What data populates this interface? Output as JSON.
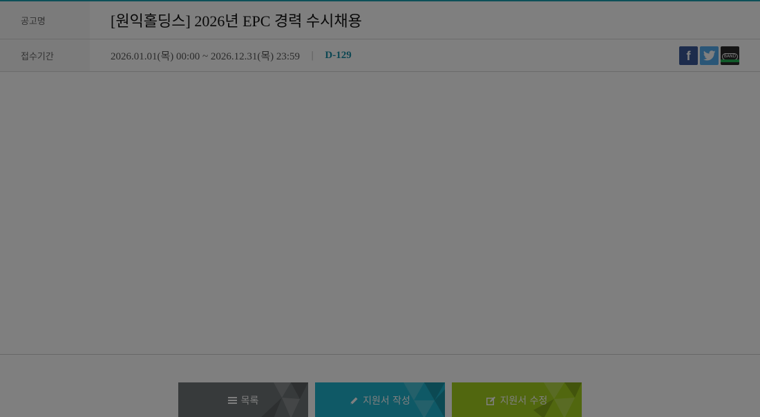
{
  "posting": {
    "title_label": "공고명",
    "title": "[원익홀딩스] 2026년 EPC 경력 수시채용",
    "period_label": "접수기간",
    "period": "2026.01.01(목) 00:00 ~ 2026.12.31(목) 23:59",
    "separator": "|",
    "d_day": "D-129"
  },
  "share": {
    "facebook_glyph": "f",
    "band_text": "BAND"
  },
  "actions": {
    "list_label": "목록",
    "write_label": "지원서 작성",
    "edit_label": "지원서 수정"
  },
  "colors": {
    "accent": "#1a9fb0",
    "d_day": "#1a8fa6",
    "list_button": "#6f7477",
    "write_button": "#1fb3cc",
    "edit_button": "#a3cf1f",
    "facebook": "#3b5998",
    "twitter": "#55acee",
    "band": "#2b2b2b",
    "modal_overlay": "rgba(0,0,0,0.5)"
  },
  "icons": {
    "list": "list-icon",
    "write": "pencil-icon",
    "edit": "edit-icon",
    "facebook": "facebook-icon",
    "twitter": "twitter-icon",
    "band": "band-icon"
  }
}
